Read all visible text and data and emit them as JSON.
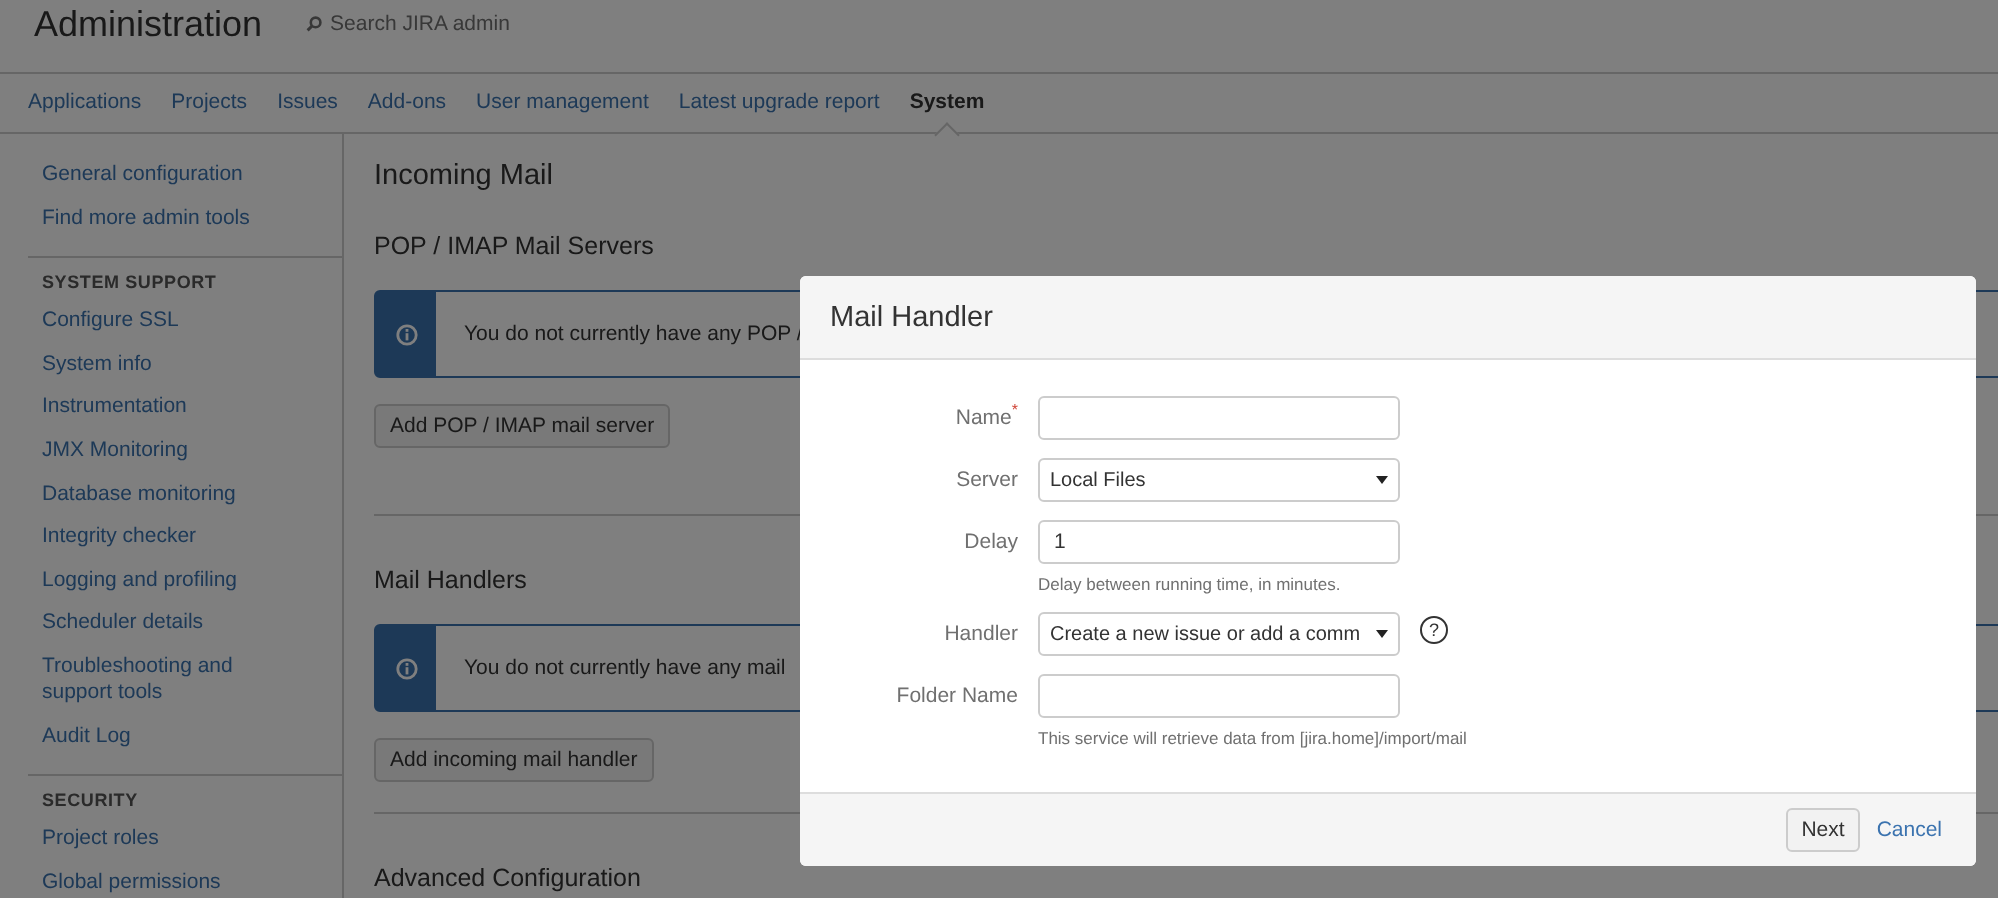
{
  "header": {
    "title": "Administration",
    "search_placeholder": "Search JIRA admin"
  },
  "nav": [
    {
      "label": "Applications",
      "selected": false
    },
    {
      "label": "Projects",
      "selected": false
    },
    {
      "label": "Issues",
      "selected": false
    },
    {
      "label": "Add-ons",
      "selected": false
    },
    {
      "label": "User management",
      "selected": false
    },
    {
      "label": "Latest upgrade report",
      "selected": false
    },
    {
      "label": "System",
      "selected": true
    }
  ],
  "sidebar": {
    "sections": [
      {
        "items": [
          "General configuration",
          "Find more admin tools"
        ]
      },
      {
        "heading": "SYSTEM SUPPORT",
        "items": [
          "Configure SSL",
          "System info",
          "Instrumentation",
          "JMX Monitoring",
          "Database monitoring",
          "Integrity checker",
          "Logging and profiling",
          "Scheduler details",
          "Troubleshooting and support tools",
          "Audit Log"
        ]
      },
      {
        "heading": "SECURITY",
        "items": [
          "Project roles",
          "Global permissions"
        ]
      }
    ]
  },
  "main": {
    "title": "Incoming Mail",
    "sections": [
      {
        "heading": "POP / IMAP Mail Servers",
        "message": "You do not currently have any POP /",
        "button": "Add POP / IMAP mail server"
      },
      {
        "heading": "Mail Handlers",
        "message": "You do not currently have any mail",
        "button": "Add incoming mail handler"
      }
    ],
    "trailing_heading": "Advanced Configuration"
  },
  "dialog": {
    "title": "Mail Handler",
    "fields": [
      {
        "kind": "text",
        "label": "Name$^{*}$"
      },
      {
        "kind": "select",
        "label": "Server",
        "value": "Local Files"
      },
      {
        "kind": "text",
        "label": "Delay",
        "value": "1",
        "hint": "Delay between running time, in minutes."
      },
      {
        "kind": "select",
        "label": "Handler",
        "value": "Create a new issue or add a comm",
        "help": "?"
      },
      {
        "kind": "text",
        "label": "Folder Name",
        "hint": "This service will retrieve data from [jira.home]/import/mail"
      }
    ],
    "next": "Next",
    "cancel": "Cancel"
  }
}
